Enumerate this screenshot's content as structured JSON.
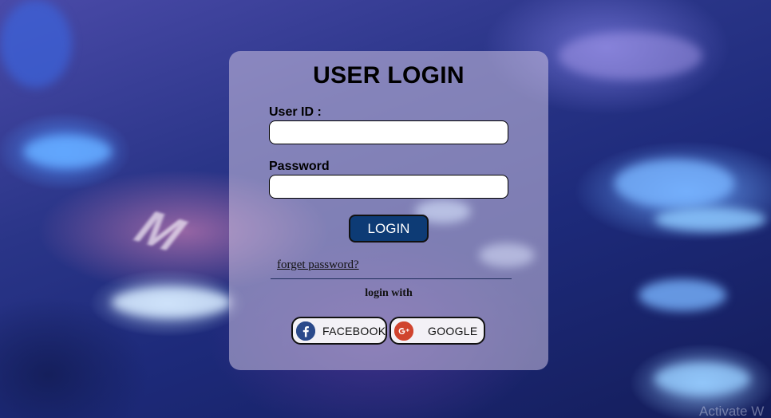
{
  "login_card": {
    "title": "USER LOGIN",
    "user_id_label": "User ID :",
    "user_id_value": "",
    "password_label": "Password",
    "password_value": "",
    "login_button": "LOGIN",
    "forget_password_link": "forget password?",
    "login_with_text": "login with",
    "social": {
      "facebook_label": "FACEBOOK",
      "facebook_icon": "facebook-icon",
      "google_label": "GOOGLE",
      "google_icon": "google-plus-icon"
    }
  },
  "watermark": "Activate W",
  "colors": {
    "login_button_bg": "#0d3b75",
    "facebook_blue": "#2b4a8b",
    "google_red": "#d0442e"
  }
}
